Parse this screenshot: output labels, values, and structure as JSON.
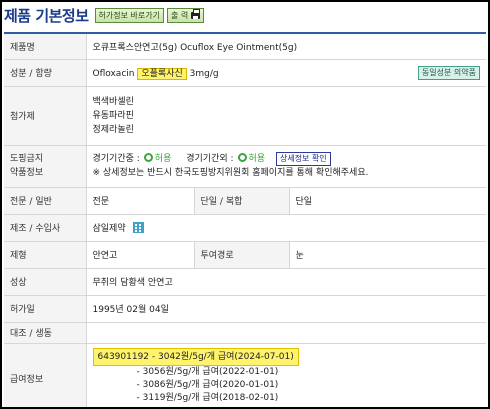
{
  "header": {
    "title": "제품 기본정보",
    "permit_shortcut": "허가정보 바로가기",
    "print": "출 력",
    "print_icon": "printer-icon"
  },
  "rows": {
    "product_name": {
      "label": "제품명",
      "value": "오큐프록스안연고(5g) Ocuflox Eye Ointment(5g)"
    },
    "ingredient": {
      "label": "성분 / 함량",
      "ingredient_en": "Ofloxacin",
      "ingredient_ko": "오플록사신",
      "amount": "3mg/g",
      "same_button": "동일성분 의약품"
    },
    "additives": {
      "label": "첨가제",
      "items": [
        "백색바셀린",
        "유동파라핀",
        "정제라놀린"
      ]
    },
    "doping": {
      "label_line1": "도핑금지",
      "label_line2": "약품정보",
      "in_comp_label": "경기기간중 :",
      "in_comp_value": "허용",
      "out_comp_label": "경기기간외 :",
      "out_comp_value": "허용",
      "detail_button": "상세정보 확인",
      "note": "※ 상세정보는 반드시 한국도핑방지위원회 홈페이지를 통해 확인해주세요."
    },
    "class": {
      "label": "전문 / 일반",
      "value": "전문",
      "label2": "단일 / 복합",
      "value2": "단일"
    },
    "maker": {
      "label": "제조 / 수입사",
      "value": "삼일제약",
      "icon": "building-icon"
    },
    "form": {
      "label": "제형",
      "value": "안연고",
      "label2": "투여경로",
      "value2": "눈"
    },
    "appearance": {
      "label": "성상",
      "value": "무취의 담황색 안연고"
    },
    "permit_date": {
      "label": "허가일",
      "value": "1995년 02월 04일"
    },
    "control": {
      "label": "대조 / 생동",
      "value": ""
    },
    "insurance": {
      "label": "급여정보",
      "first": "643901192 - 3042원/5g/개 급여(2024-07-01)",
      "history": [
        "- 3056원/5g/개 급여(2022-01-01)",
        "- 3086원/5g/개 급여(2020-01-01)",
        "- 3119원/5g/개 급여(2018-02-01)"
      ]
    }
  },
  "colors": {
    "title": "#1a3a8a",
    "highlight": "#fff36b",
    "allowed": "#3aa53a",
    "table_top": "#2f5d9f"
  }
}
